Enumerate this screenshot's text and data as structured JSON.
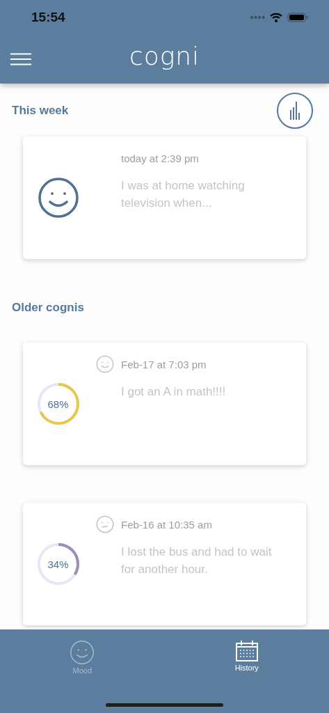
{
  "status_bar": {
    "time": "15:54"
  },
  "header": {
    "title": "cogni"
  },
  "sections": [
    {
      "title": "This week",
      "entries": [
        {
          "kind": "happy",
          "date": "today at 2:39 pm",
          "text": "I was at home watching television when..."
        }
      ]
    },
    {
      "title": "Older cognis",
      "entries": [
        {
          "kind": "happy",
          "date": "Feb-17 at 7:03 pm",
          "text": "I got an A in math!!!!",
          "percent": "68%",
          "level": 0.68,
          "color": "#e6c84a"
        },
        {
          "kind": "neutral",
          "date": "Feb-16 at 10:35 am",
          "text": "I lost the bus and had to wait for another hour.",
          "percent": "34%",
          "level": 0.34,
          "color": "#9d8bb8"
        }
      ]
    }
  ],
  "tabs": [
    {
      "label": "Mood",
      "kind": "mood",
      "selected": false
    },
    {
      "label": "History",
      "kind": "calendar",
      "selected": true
    }
  ]
}
